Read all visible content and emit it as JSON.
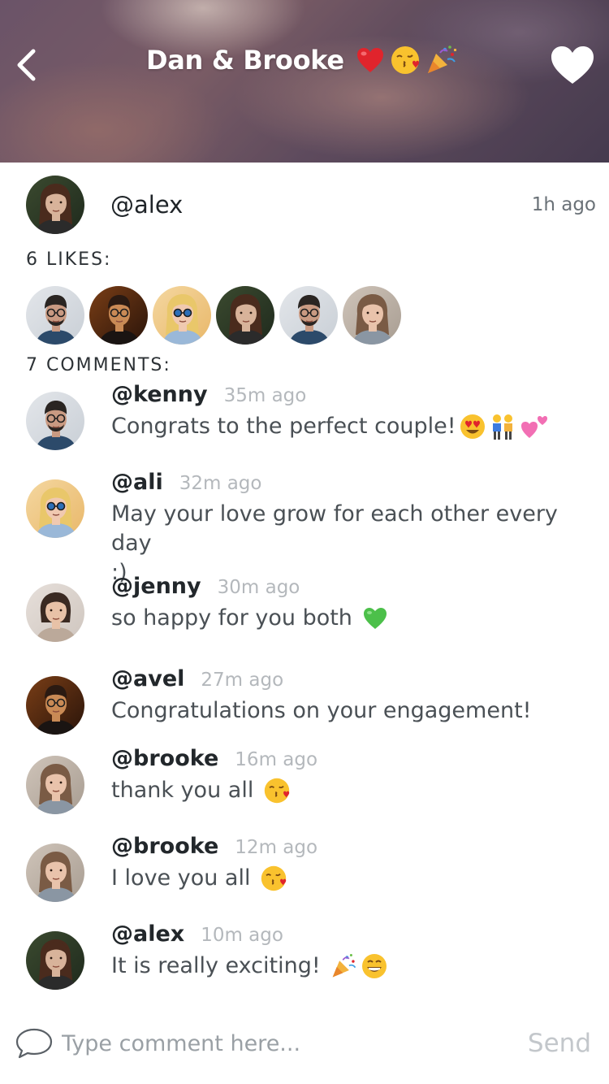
{
  "header": {
    "title": "Dan & Brooke",
    "title_emojis": [
      "red-heart",
      "face-blowing-kiss",
      "party-popper"
    ],
    "back_icon": "chevron-left-icon",
    "like_icon": "heart-icon"
  },
  "post": {
    "username": "@alex",
    "time": "1h ago",
    "avatar": "alex"
  },
  "likes": {
    "label": "6 LIKES:",
    "avatars": [
      "kenny",
      "avel",
      "ali",
      "alex",
      "kenny",
      "brooke"
    ]
  },
  "comments": {
    "label": "7 COMMENTS:",
    "items": [
      {
        "user": "@kenny",
        "time": "35m ago",
        "lines": [
          "Congrats to the perfect couple!"
        ],
        "emojis": [
          "heart-eyes",
          "couple",
          "two-hearts"
        ],
        "avatar": "kenny"
      },
      {
        "user": "@ali",
        "time": "32m ago",
        "lines": [
          "May your love grow for each other every day",
          ":)"
        ],
        "emojis": [],
        "avatar": "ali"
      },
      {
        "user": "@jenny",
        "time": "30m ago",
        "lines": [
          "so happy for you both"
        ],
        "emojis": [
          "green-heart"
        ],
        "avatar": "jenny"
      },
      {
        "user": "@avel",
        "time": "27m ago",
        "lines": [
          "Congratulations on your engagement!"
        ],
        "emojis": [],
        "avatar": "avel"
      },
      {
        "user": "@brooke",
        "time": "16m ago",
        "lines": [
          "thank you all"
        ],
        "emojis": [
          "face-blowing-kiss"
        ],
        "avatar": "brooke"
      },
      {
        "user": "@brooke",
        "time": "12m ago",
        "lines": [
          "I love you all"
        ],
        "emojis": [
          "face-blowing-kiss"
        ],
        "avatar": "brooke"
      },
      {
        "user": "@alex",
        "time": "10m ago",
        "lines": [
          "It is really exciting!"
        ],
        "emojis": [
          "party-popper",
          "grinning-face"
        ],
        "avatar": "alex"
      }
    ]
  },
  "composer": {
    "placeholder": "Type comment here...",
    "send_label": "Send",
    "icon": "speech-bubble-icon"
  },
  "colors": {
    "primary_text": "#22272b",
    "secondary_text": "#4a5055",
    "muted_text": "#b4b8bc",
    "send_disabled": "#c3c7cb",
    "white": "#ffffff"
  }
}
